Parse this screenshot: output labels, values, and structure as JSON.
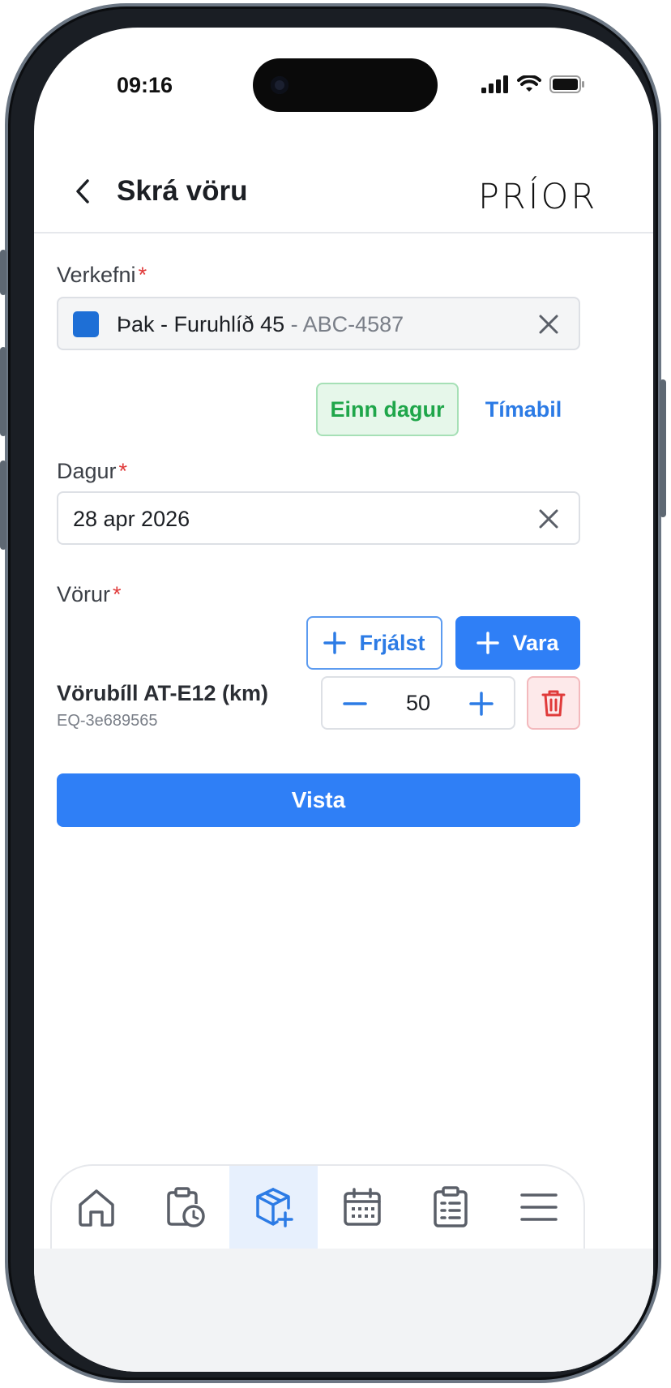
{
  "status_bar": {
    "time": "09:16"
  },
  "header": {
    "title": "Skrá vöru",
    "logo_text": "PRÍOR"
  },
  "project": {
    "label": "Verkefni",
    "required_mark": "*",
    "value_name": "Þak - Furuhlíð 45",
    "value_code": " - ABC-4587",
    "swatch_color": "#1e6fd6"
  },
  "date_mode": {
    "options": [
      {
        "label": "Einn dagur",
        "selected": true
      },
      {
        "label": "Tímabil",
        "selected": false
      }
    ]
  },
  "date": {
    "label": "Dagur",
    "required_mark": "*",
    "value": "28 apr 2026"
  },
  "products": {
    "label": "Vörur",
    "required_mark": "*",
    "free_button": "Frjálst",
    "product_button": "Vara",
    "items": [
      {
        "name": "Vörubíll AT-E12 (km)",
        "code": "EQ-3e689565",
        "quantity": "50"
      }
    ]
  },
  "save_button": "Vista",
  "bottom_nav": {
    "items": [
      {
        "icon": "home-icon",
        "active": false
      },
      {
        "icon": "clipboard-clock-icon",
        "active": false
      },
      {
        "icon": "package-add-icon",
        "active": true
      },
      {
        "icon": "calendar-icon",
        "active": false
      },
      {
        "icon": "checklist-icon",
        "active": false
      },
      {
        "icon": "menu-icon",
        "active": false
      }
    ]
  },
  "colors": {
    "accent": "#2f7ff6",
    "success": "#1fa64a",
    "danger": "#e03a3a"
  }
}
